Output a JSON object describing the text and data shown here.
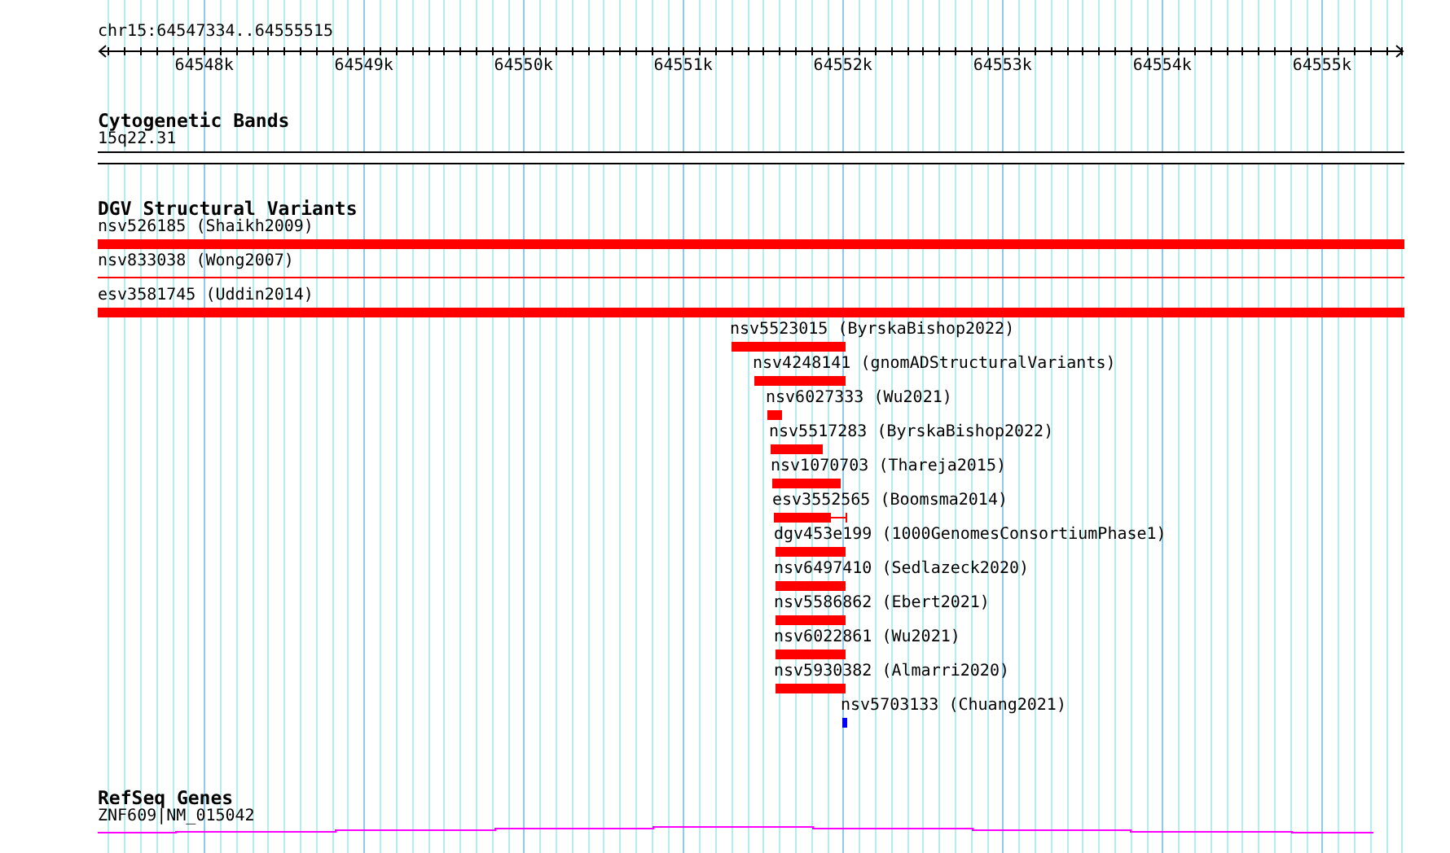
{
  "locus": "chr15:64547334..64555515",
  "ruler": {
    "ticks": [
      "64548k",
      "64549k",
      "64550k",
      "64551k",
      "64552k",
      "64553k",
      "64554k",
      "64555k"
    ]
  },
  "tracks": [
    {
      "kind": "bands",
      "title": "Cytogenetic Bands",
      "features": [
        {
          "label": "15q22.31"
        }
      ]
    },
    {
      "kind": "variants",
      "title": "DGV Structural Variants",
      "features": [
        {
          "label": "nsv526185 (Shaikh2009)",
          "kind": "bar",
          "color": "#ff0000"
        },
        {
          "label": "nsv833038 (Wong2007)",
          "kind": "line",
          "color": "#ff0000"
        },
        {
          "label": "esv3581745 (Uddin2014)",
          "kind": "bar",
          "color": "#ff0000"
        },
        {
          "label": "nsv5523015 (ByrskaBishop2022)",
          "kind": "bar",
          "color": "#ff0000"
        },
        {
          "label": "nsv4248141 (gnomADStructuralVariants)",
          "kind": "bar",
          "color": "#ff0000"
        },
        {
          "label": "nsv6027333 (Wu2021)",
          "kind": "bar",
          "color": "#ff0000"
        },
        {
          "label": "nsv5517283 (ByrskaBishop2022)",
          "kind": "bar",
          "color": "#ff0000"
        },
        {
          "label": "nsv1070703 (Thareja2015)",
          "kind": "bar",
          "color": "#ff0000"
        },
        {
          "label": "esv3552565 (Boomsma2014)",
          "kind": "whisker",
          "color": "#ff0000"
        },
        {
          "label": "dgv453e199 (1000GenomesConsortiumPhase1)",
          "kind": "bar",
          "color": "#ff0000"
        },
        {
          "label": "nsv6497410 (Sedlazeck2020)",
          "kind": "bar",
          "color": "#ff0000"
        },
        {
          "label": "nsv5586862 (Ebert2021)",
          "kind": "bar",
          "color": "#ff0000"
        },
        {
          "label": "nsv6022861 (Wu2021)",
          "kind": "bar",
          "color": "#ff0000"
        },
        {
          "label": "nsv5930382 (Almarri2020)",
          "kind": "bar",
          "color": "#ff0000"
        },
        {
          "label": "nsv5703133 (Chuang2021)",
          "kind": "bar",
          "color": "#0000ff"
        }
      ]
    },
    {
      "kind": "genes",
      "title": "RefSeq Genes",
      "features": [
        {
          "label": "ZNF609|NM_015042"
        }
      ]
    }
  ]
}
